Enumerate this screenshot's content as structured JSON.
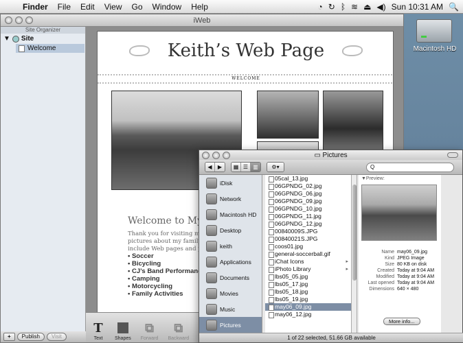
{
  "menubar": {
    "apple": "",
    "items": [
      "Finder",
      "File",
      "Edit",
      "View",
      "Go",
      "Window",
      "Help"
    ],
    "clock": "Sun 10:31 AM"
  },
  "desktop": {
    "hd_label": "Macintosh HD"
  },
  "iweb": {
    "title": "iWeb",
    "organizer_header": "Site Organizer",
    "site_label": "Site",
    "page_label": "Welcome",
    "page": {
      "title": "Keith’s Web Page",
      "nav": "WELCOME",
      "welcome_heading": "Welcome to My Worl",
      "body_lines": [
        "Thank you for visiting my Web",
        "pictures about my family and I.",
        "include Web pages and pictures"
      ],
      "bullets": [
        "Soccer",
        "Bicycling",
        "CJ’s Band Performances",
        "Camping",
        "Motorcycling",
        "Family Activities"
      ]
    },
    "toolbar": [
      "Text",
      "Shapes",
      "Forward",
      "Backward"
    ],
    "bottom": {
      "add": "+",
      "publish": "Publish",
      "visit": "Visit"
    }
  },
  "finder": {
    "title": "Pictures",
    "search_placeholder": "Q",
    "sidebar": [
      "iDisk",
      "Network",
      "Macintosh HD",
      "Desktop",
      "keith",
      "Applications",
      "Documents",
      "Movies",
      "Music",
      "Pictures"
    ],
    "files": [
      {
        "name": "05cal_13.jpg",
        "arrow": false
      },
      {
        "name": "06GPNDG_02.jpg",
        "arrow": false
      },
      {
        "name": "06GPNDG_06.jpg",
        "arrow": false
      },
      {
        "name": "06GPNDG_09.jpg",
        "arrow": false
      },
      {
        "name": "06GPNDG_10.jpg",
        "arrow": false
      },
      {
        "name": "06GPNDG_11.jpg",
        "arrow": false
      },
      {
        "name": "06GPNDG_12.jpg",
        "arrow": false
      },
      {
        "name": "00840009S.JPG",
        "arrow": false
      },
      {
        "name": "00840021S.JPG",
        "arrow": false
      },
      {
        "name": "coos01.jpg",
        "arrow": false
      },
      {
        "name": "general-soccerball.gif",
        "arrow": false
      },
      {
        "name": "iChat Icons",
        "arrow": true
      },
      {
        "name": "iPhoto Library",
        "arrow": true
      },
      {
        "name": "lbs05_05.jpg",
        "arrow": false
      },
      {
        "name": "lbs05_17.jpg",
        "arrow": false
      },
      {
        "name": "lbs05_18.jpg",
        "arrow": false
      },
      {
        "name": "lbs05_19.jpg",
        "arrow": false
      },
      {
        "name": "may06_09.jpg",
        "arrow": false
      },
      {
        "name": "may06_12.jpg",
        "arrow": false
      }
    ],
    "selected_index": 17,
    "preview": {
      "label": "▼Preview:",
      "info": [
        {
          "k": "Name",
          "v": "may06_09.jpg"
        },
        {
          "k": "Kind",
          "v": "JPEG Image"
        },
        {
          "k": "Size",
          "v": "80 KB on disk"
        },
        {
          "k": "Created",
          "v": "Today at 9:04 AM"
        },
        {
          "k": "Modified",
          "v": "Today at 9:04 AM"
        },
        {
          "k": "Last opened",
          "v": "Today at 9:04 AM"
        },
        {
          "k": "Dimensions",
          "v": "640 × 480"
        }
      ],
      "more_button": "More info..."
    },
    "status": "1 of 22 selected, 51.66 GB available"
  }
}
